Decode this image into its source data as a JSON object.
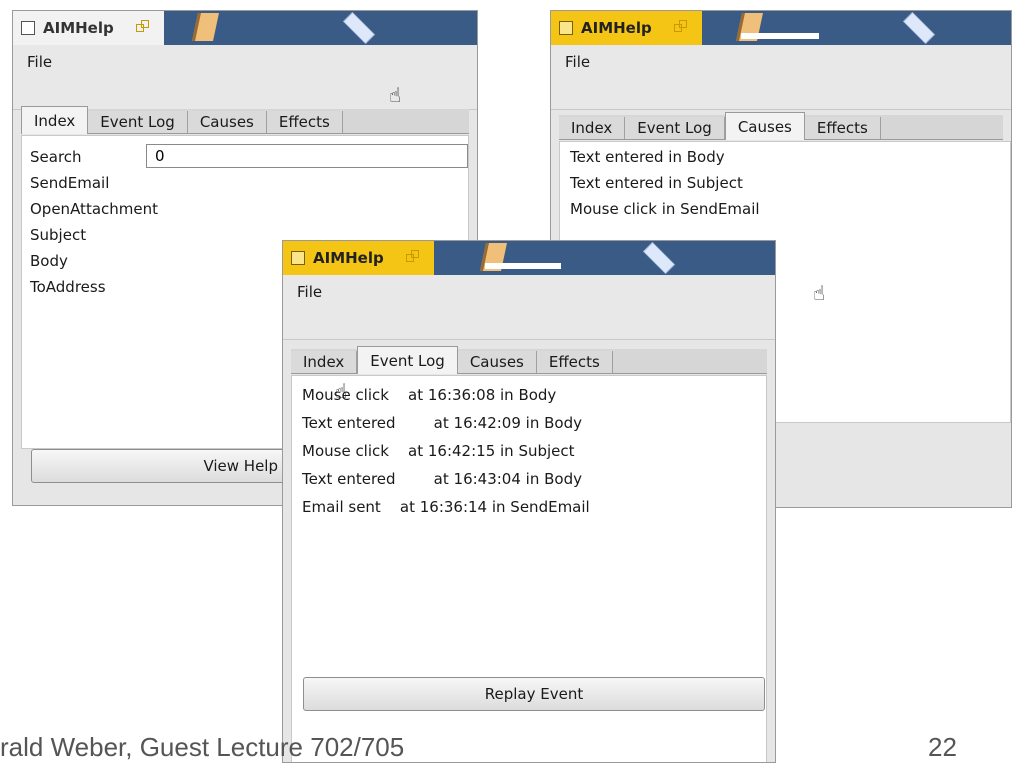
{
  "footer": {
    "text": "rald Weber, Guest Lecture 702/705",
    "page_number": "22"
  },
  "windows": {
    "index": {
      "title": "AIMHelp",
      "menu": {
        "file": "File"
      },
      "tabs": {
        "index": "Index",
        "event_log": "Event Log",
        "causes": "Causes",
        "effects": "Effects"
      },
      "selected_tab": "Index",
      "search": {
        "label": "Search",
        "value": "0"
      },
      "items": [
        "SendEmail",
        "OpenAttachment",
        "Subject",
        "Body",
        "ToAddress"
      ],
      "button": "View Help To"
    },
    "causes": {
      "title": "AIMHelp",
      "menu": {
        "file": "File"
      },
      "tabs": {
        "index": "Index",
        "event_log": "Event Log",
        "causes": "Causes",
        "effects": "Effects"
      },
      "selected_tab": "Causes",
      "items": [
        "Text entered in Body",
        "Text entered in Subject",
        "Mouse click in SendEmail"
      ]
    },
    "event_log": {
      "title": "AIMHelp",
      "menu": {
        "file": "File"
      },
      "tabs": {
        "index": "Index",
        "event_log": "Event Log",
        "causes": "Causes",
        "effects": "Effects"
      },
      "selected_tab": "Event Log",
      "items": [
        "Mouse click    at 16:36:08 in Body",
        "Text entered        at 16:42:09 in Body",
        "Mouse click    at 16:42:15 in Subject",
        "Text entered        at 16:43:04 in Body",
        "Email sent    at 16:36:14 in SendEmail"
      ],
      "button": "Replay Event"
    }
  },
  "colors": {
    "titlebar": "#3a5b86",
    "active_title": "#f4c514",
    "inactive_title": "#f2f2f2"
  },
  "icons": {
    "cursor": "hand-pointer-icon",
    "title_menu": "checkbox-icon",
    "restore": "restore-icon"
  }
}
